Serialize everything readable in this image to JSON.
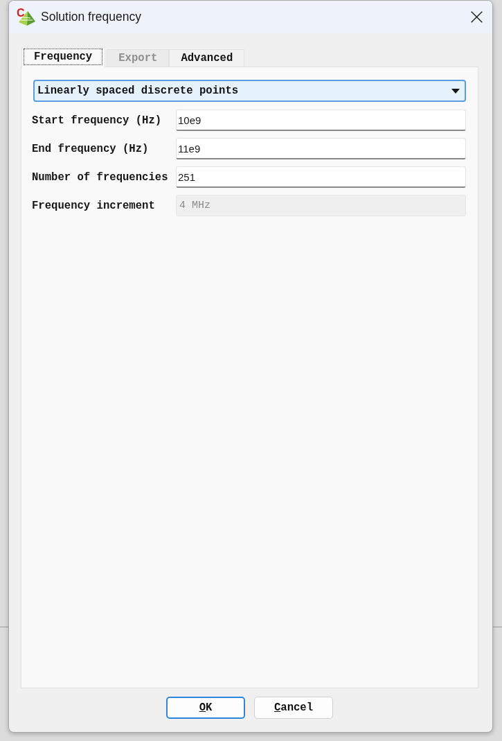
{
  "window": {
    "title": "Solution frequency",
    "icon_letter": "C"
  },
  "tabs": [
    {
      "label": "Frequency",
      "selected": true,
      "disabled": false
    },
    {
      "label": "Export",
      "selected": false,
      "disabled": true
    },
    {
      "label": "Advanced",
      "selected": false,
      "disabled": false
    }
  ],
  "mode_dropdown": {
    "value": "Linearly spaced discrete points",
    "focused": true
  },
  "fields": [
    {
      "label": "Start frequency (Hz)",
      "value": "10e9",
      "disabled": false
    },
    {
      "label": "End frequency (Hz)",
      "value": "11e9",
      "disabled": false
    },
    {
      "label": "Number of frequencies",
      "value": "251",
      "disabled": false
    },
    {
      "label": "Frequency increment",
      "value": "4 MHz",
      "disabled": true
    }
  ],
  "buttons": [
    {
      "label": "OK",
      "default": true
    },
    {
      "label": "Cancel",
      "default": false
    }
  ]
}
